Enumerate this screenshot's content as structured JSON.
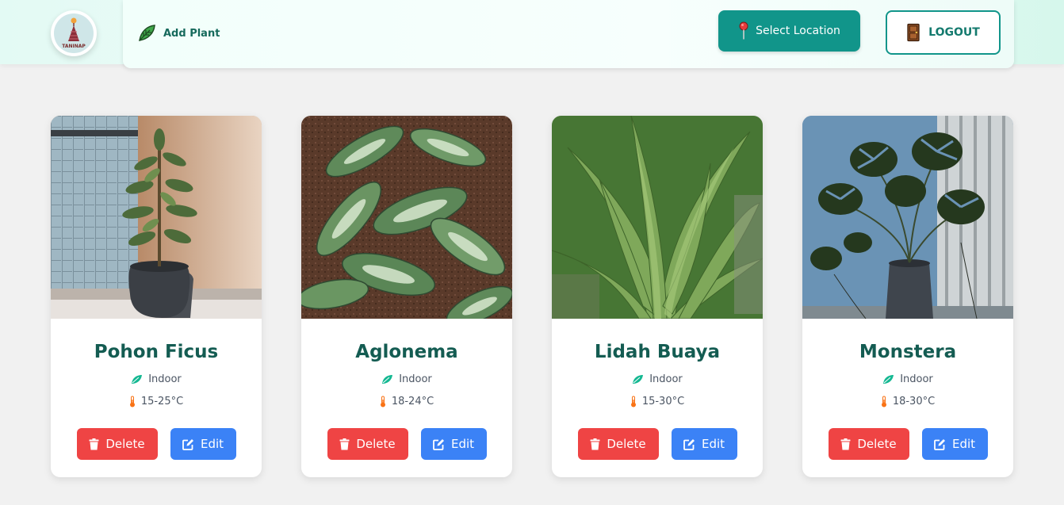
{
  "header": {
    "logo_text": "TANINAP",
    "add_plant_label": "Add Plant",
    "select_location_label": "Select Location",
    "logout_label": "LOGOUT"
  },
  "colors": {
    "primary": "#11958a",
    "delete": "#ef4444",
    "edit": "#3b82f6",
    "title": "#145c52",
    "leaf": "#14b892",
    "thermo": "#f97316"
  },
  "plants": [
    {
      "name": "Pohon Ficus",
      "type": "Indoor",
      "temp": "15-25°C",
      "delete_label": "Delete",
      "edit_label": "Edit",
      "image": "ficus-potted-photo"
    },
    {
      "name": "Aglonema",
      "type": "Indoor",
      "temp": "18-24°C",
      "delete_label": "Delete",
      "edit_label": "Edit",
      "image": "aglonema-leaves-photo"
    },
    {
      "name": "Lidah Buaya",
      "type": "Indoor",
      "temp": "15-30°C",
      "delete_label": "Delete",
      "edit_label": "Edit",
      "image": "aloe-vera-photo"
    },
    {
      "name": "Monstera",
      "type": "Indoor",
      "temp": "18-30°C",
      "delete_label": "Delete",
      "edit_label": "Edit",
      "image": "monstera-potted-photo"
    }
  ],
  "icons": {
    "add_plant": "leaf-icon",
    "location": "pin-icon",
    "logout": "door-icon",
    "type": "leaf-icon",
    "temp": "thermometer-icon",
    "delete": "trash-icon",
    "edit": "edit-icon"
  }
}
